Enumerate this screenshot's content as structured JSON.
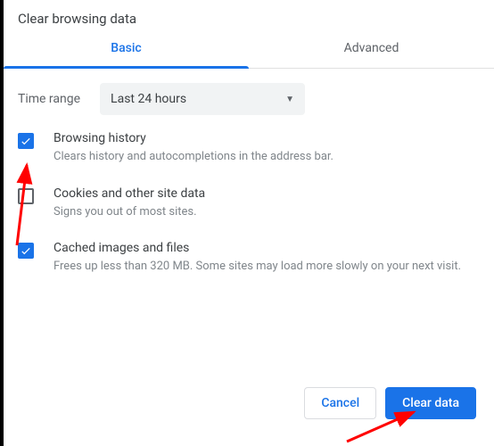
{
  "title": "Clear browsing data",
  "tabs": {
    "basic": "Basic",
    "advanced": "Advanced"
  },
  "time": {
    "label": "Time range",
    "selected": "Last 24 hours"
  },
  "options": [
    {
      "checked": true,
      "title": "Browsing history",
      "desc": "Clears history and autocompletions in the address bar."
    },
    {
      "checked": false,
      "title": "Cookies and other site data",
      "desc": "Signs you out of most sites."
    },
    {
      "checked": true,
      "title": "Cached images and files",
      "desc": "Frees up less than 320 MB. Some sites may load more slowly on your next visit."
    }
  ],
  "buttons": {
    "cancel": "Cancel",
    "clear": "Clear data"
  }
}
